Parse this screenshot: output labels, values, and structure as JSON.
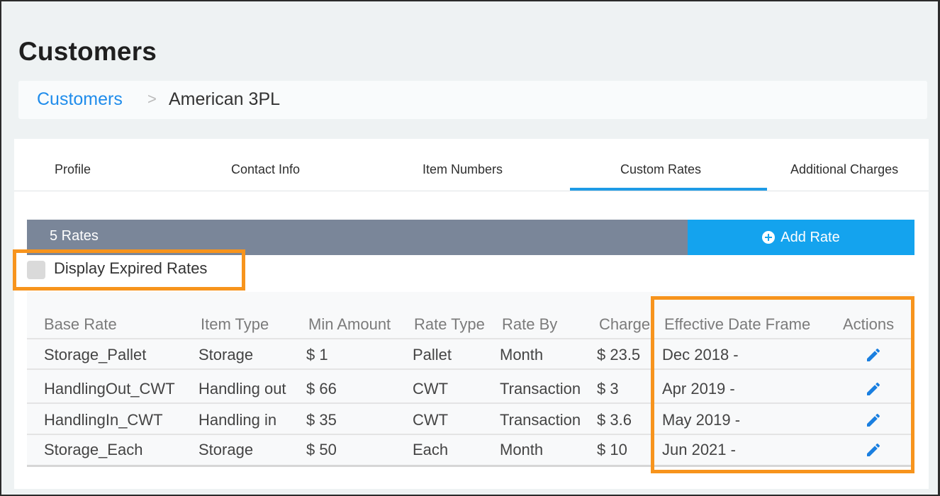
{
  "page": {
    "title": "Customers"
  },
  "breadcrumb": {
    "parent": "Customers",
    "separator": ">",
    "current": "American 3PL"
  },
  "tabs": [
    {
      "label": "Profile",
      "active": false
    },
    {
      "label": "Contact Info",
      "active": false
    },
    {
      "label": "Item Numbers",
      "active": false
    },
    {
      "label": "Custom Rates",
      "active": true
    },
    {
      "label": "Additional Charges",
      "active": false
    }
  ],
  "rates_bar": {
    "count_label": "5 Rates",
    "add_label": "Add Rate",
    "add_icon": "plus-circle-icon"
  },
  "expired": {
    "label": "Display Expired Rates",
    "checked": false
  },
  "table": {
    "headers": [
      "Base Rate",
      "Item Type",
      "Min Amount",
      "Rate Type",
      "Rate By",
      "Charge",
      "Effective Date Frame",
      "Actions"
    ],
    "rows": [
      {
        "base_rate": "Storage_Pallet",
        "item_type": "Storage",
        "min_amount": "$ 1",
        "rate_type": "Pallet",
        "rate_by": "Month",
        "charge": "$ 23.5",
        "effective": "Dec 2018 -",
        "action_icon": "pencil-icon"
      },
      {
        "base_rate": "HandlingOut_CWT",
        "item_type": "Handling out",
        "min_amount": "$ 66",
        "rate_type": "CWT",
        "rate_by": "Transaction",
        "charge": "$ 3",
        "effective": "Apr 2019 -",
        "action_icon": "pencil-icon"
      },
      {
        "base_rate": "HandlingIn_CWT",
        "item_type": "Handling in",
        "min_amount": "$ 35",
        "rate_type": "CWT",
        "rate_by": "Transaction",
        "charge": "$ 3.6",
        "effective": "May 2019 -",
        "action_icon": "pencil-icon"
      },
      {
        "base_rate": "Storage_Each",
        "item_type": "Storage",
        "min_amount": "$ 50",
        "rate_type": "Each",
        "rate_by": "Month",
        "charge": "$ 10",
        "effective": "Jun 2021 -",
        "action_icon": "pencil-icon"
      }
    ]
  },
  "colors": {
    "accent": "#1e9be6",
    "add_button": "#14a3ee",
    "rates_bar": "#7a8699",
    "highlight": "#f7941d",
    "link": "#1f8ceb",
    "pencil": "#1a7fe0"
  }
}
